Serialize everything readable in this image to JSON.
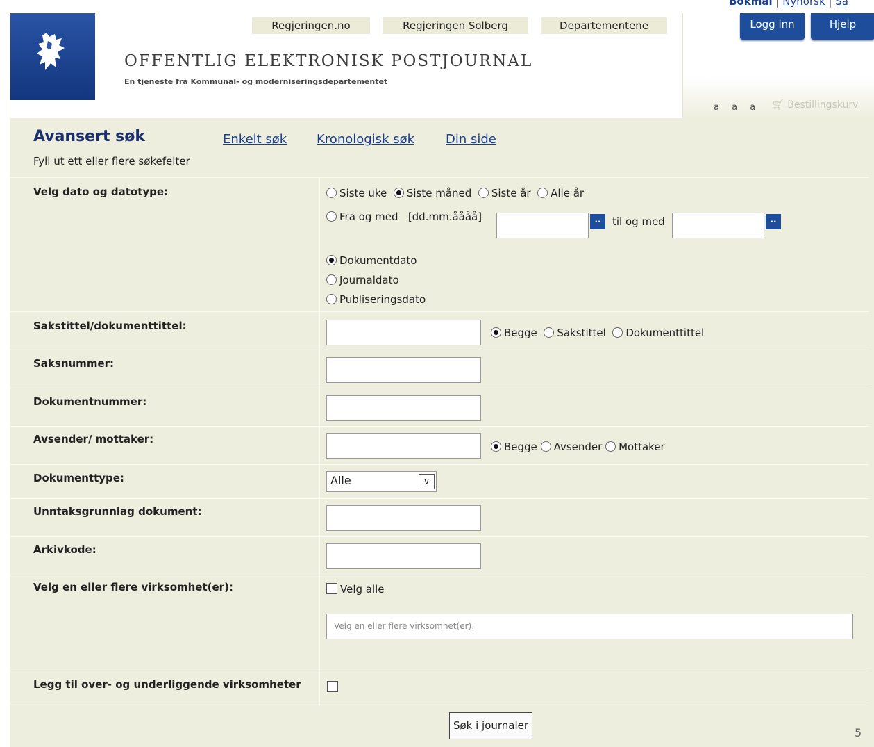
{
  "lang_links": {
    "bokmal": "Bokmål",
    "nynorsk": "Nynorsk",
    "samisk": "Sa"
  },
  "nav": {
    "regjeringen": "Regjeringen.no",
    "solberg": "Regjeringen Solberg",
    "departementene": "Departementene"
  },
  "header": {
    "title": "OFFENTLIG ELEKTRONISK POSTJOURNAL",
    "subtitle": "En tjeneste fra Kommunal- og moderniseringsdepartementet"
  },
  "top_buttons": {
    "login": "Logg inn",
    "help": "Hjelp"
  },
  "font_size_label": "a a a",
  "cart_label": "Bestillingskurv",
  "search": {
    "heading": "Avansert søk",
    "instruction": "Fyll ut ett eller flere søkefelter",
    "tabs": {
      "simple": "Enkelt søk",
      "chrono": "Kronologisk søk",
      "mypage": "Din side"
    }
  },
  "date": {
    "label": "Velg dato og datotype:",
    "periods": [
      "Siste uke",
      "Siste måned",
      "Siste år",
      "Alle år"
    ],
    "selected_period": "Siste måned",
    "from_label": "Fra og med",
    "format_hint": "[dd.mm.åååå]",
    "to_label": "til og med",
    "cal_button": "..",
    "types": [
      "Dokumentdato",
      "Journaldato",
      "Publiseringsdato"
    ],
    "selected_type": "Dokumentdato"
  },
  "title_field": {
    "label": "Sakstittel/dokumenttittel:",
    "options": [
      "Begge",
      "Sakstittel",
      "Dokumenttittel"
    ],
    "selected": "Begge"
  },
  "case_number": {
    "label": "Saksnummer:"
  },
  "doc_number": {
    "label": "Dokumentnummer:"
  },
  "sender": {
    "label": "Avsender/ mottaker:",
    "options": [
      "Begge",
      "Avsender",
      "Mottaker"
    ],
    "selected": "Begge"
  },
  "doc_type": {
    "label": "Dokumenttype:",
    "value": "Alle"
  },
  "exemption": {
    "label": "Unntaksgrunnlag dokument:"
  },
  "archive_code": {
    "label": "Arkivkode:"
  },
  "agencies": {
    "label": "Velg en eller flere virksomhet(er):",
    "select_all": "Velg alle",
    "placeholder": "Velg en eller flere virksomhet(er):"
  },
  "sub_agencies": {
    "label": "Legg til over- og underliggende virksomheter"
  },
  "submit_label": "Søk i journaler",
  "page_number": "5",
  "colors": {
    "brand_blue": "#1d4d9b",
    "panel_bg": "#eeeedf",
    "link": "#1a3f8f"
  }
}
